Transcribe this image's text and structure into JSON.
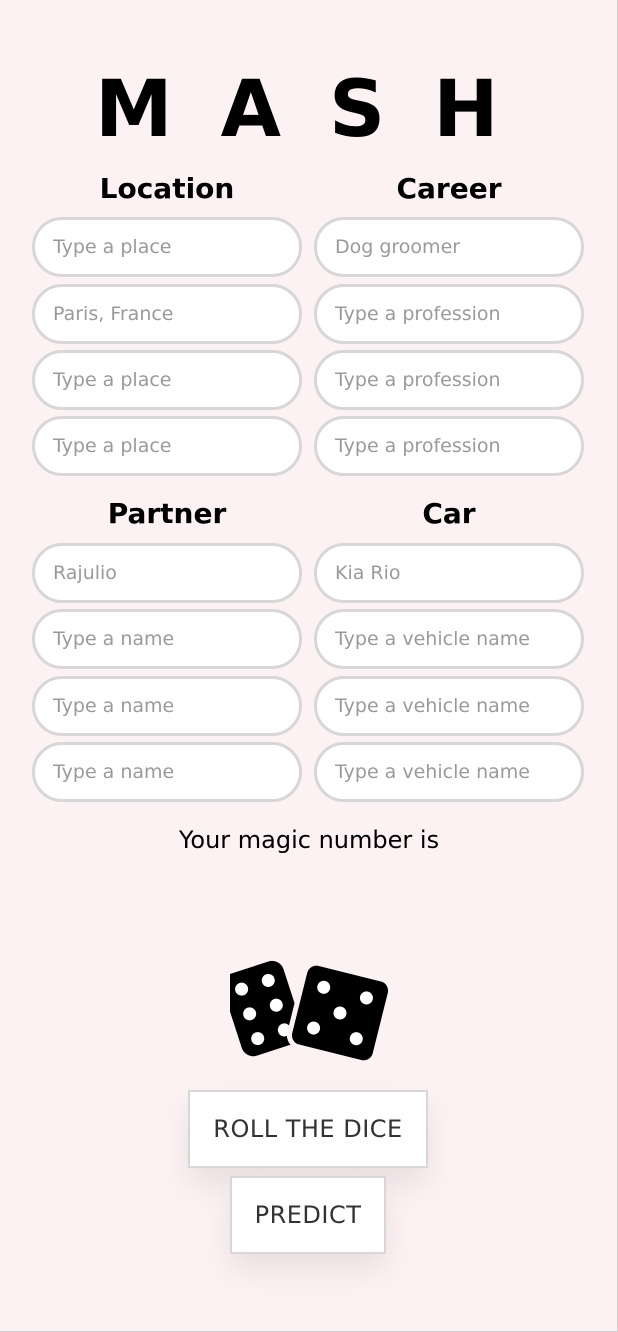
{
  "title": {
    "letters": [
      "M",
      "A",
      "S",
      "H"
    ]
  },
  "sections": {
    "location": {
      "heading": "Location",
      "fields": [
        {
          "value": "",
          "placeholder": "Type a place"
        },
        {
          "value": "",
          "placeholder": "Paris, France"
        },
        {
          "value": "",
          "placeholder": "Type a place"
        },
        {
          "value": "",
          "placeholder": "Type a place"
        }
      ]
    },
    "career": {
      "heading": "Career",
      "fields": [
        {
          "value": "",
          "placeholder": "Dog groomer"
        },
        {
          "value": "",
          "placeholder": "Type a profession"
        },
        {
          "value": "",
          "placeholder": "Type a profession"
        },
        {
          "value": "",
          "placeholder": "Type a profession"
        }
      ]
    },
    "partner": {
      "heading": "Partner",
      "fields": [
        {
          "value": "",
          "placeholder": "Rajulio"
        },
        {
          "value": "",
          "placeholder": "Type a name"
        },
        {
          "value": "",
          "placeholder": "Type a name"
        },
        {
          "value": "",
          "placeholder": "Type a name"
        }
      ]
    },
    "car": {
      "heading": "Car",
      "fields": [
        {
          "value": "",
          "placeholder": "Kia Rio"
        },
        {
          "value": "",
          "placeholder": "Type a vehicle name"
        },
        {
          "value": "",
          "placeholder": "Type a vehicle name"
        },
        {
          "value": "",
          "placeholder": "Type a vehicle name"
        }
      ]
    }
  },
  "magic_number": {
    "label": "Your magic number is",
    "value": ""
  },
  "dice": {
    "icon": "dice-icon",
    "color": "#000000"
  },
  "buttons": {
    "roll": "ROLL THE DICE",
    "predict": "PREDICT"
  }
}
